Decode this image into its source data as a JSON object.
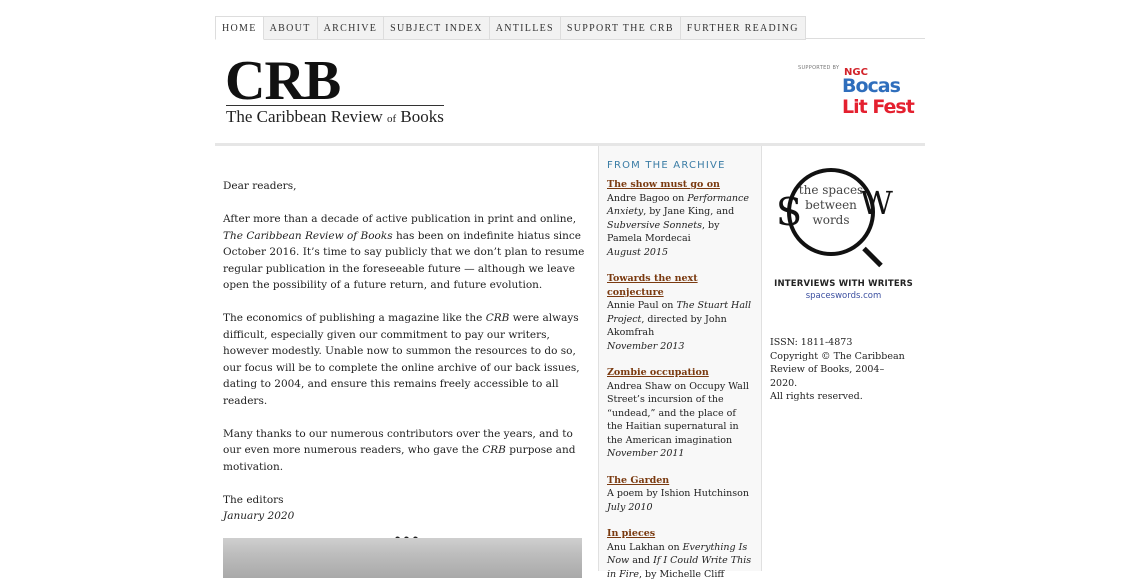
{
  "nav": [
    "HOME",
    "ABOUT",
    "ARCHIVE",
    "SUBJECT INDEX",
    "ANTILLES",
    "SUPPORT THE CRB",
    "FURTHER READING"
  ],
  "logo": {
    "mark": "CRB",
    "subtitle_a": "The Caribbean Review ",
    "subtitle_of": "of",
    "subtitle_b": " Books"
  },
  "sponsor": {
    "supported": "SUPPORTED BY",
    "ngc": "NGC",
    "bocas": "Bocas",
    "litfest": "Lit Fest"
  },
  "letter": {
    "salutation": "Dear readers,",
    "p1a": "After more than a decade of active publication in print and online, ",
    "p1_title": "The Caribbean Review of Books",
    "p1b": " has been on indefinite hiatus since October 2016. It’s time to say publicly that we don’t plan to resume regular publication in the foreseeable future — although we leave open the possibility of a future return, and future evolution.",
    "p2a": "The economics of publishing a magazine like the ",
    "p2_crb": "CRB",
    "p2b": " were always difficult, especially given our commitment to pay our writers, however modestly. Unable now to summon the resources to do so, our focus will be to complete the online archive of our back issues, dating to 2004, and ensure this remains freely accessible to all readers.",
    "p3a": "Many thanks to our numerous contributors over the years, and to our even more numerous readers, who gave the ",
    "p3_crb": "CRB",
    "p3b": " purpose and motivation.",
    "signoff": "The editors",
    "date": "January 2020",
    "dots": "•••"
  },
  "archive": {
    "heading": "FROM THE ARCHIVE",
    "entries": [
      {
        "title": "The show must go on",
        "pre": "Andre Bagoo on ",
        "it1": "Performance Anxiety",
        "mid": ", by Jane King, and ",
        "it2": "Subversive Sonnets",
        "post": ", by Pamela Mordecai",
        "date": "August 2015"
      },
      {
        "title": "Towards the next conjecture",
        "pre": "Annie Paul on ",
        "it1": "The Stuart Hall Project",
        "mid": ", directed by John Akomfrah",
        "it2": "",
        "post": "",
        "date": "November 2013"
      },
      {
        "title": "Zombie occupation",
        "pre": "Andrea Shaw on Occupy Wall Street’s incursion of the “undead,” and the place of the Haitian supernatural in the American imagination",
        "it1": "",
        "mid": "",
        "it2": "",
        "post": "",
        "date": "November 2011"
      },
      {
        "title": "The Garden",
        "pre": "A poem by Ishion Hutchinson",
        "it1": "",
        "mid": "",
        "it2": "",
        "post": "",
        "date": "July 2010"
      },
      {
        "title": "In pieces",
        "pre": "Anu Lakhan on ",
        "it1": "Everything Is Now",
        "mid": " and ",
        "it2": "If I Could Write This in Fire",
        "post": ", by Michelle Cliff",
        "date": ""
      }
    ]
  },
  "side": {
    "spaces_text": "the spaces between words",
    "spaces_S": "S",
    "spaces_W": "W",
    "interviews": "INTERVIEWS WITH WRITERS",
    "url": "spaceswords.com",
    "issn": "ISSN: 1811-4873",
    "copyright": "Copyright © The Caribbean Review of Books, 2004–2020.",
    "rights": "All rights reserved."
  }
}
